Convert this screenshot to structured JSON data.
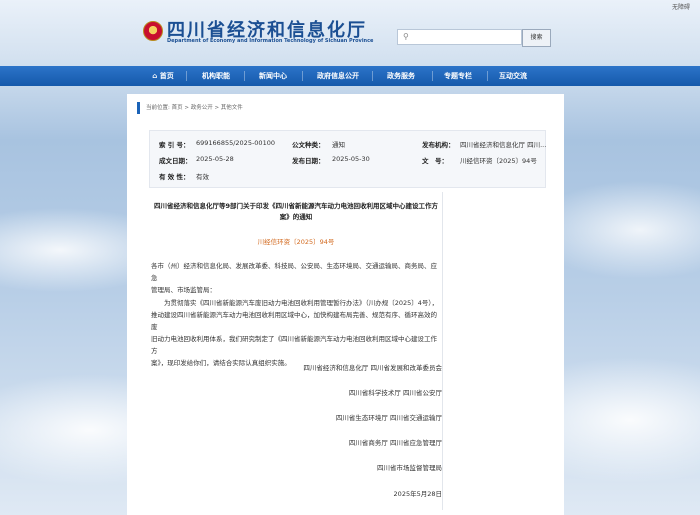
{
  "topbar": {
    "accessibility": "无障碍"
  },
  "header": {
    "site_name": "四川省经济和信息化厅",
    "site_name_en": "Department of Economy and Information Technology of Sichuan Province",
    "search_placeholder": "",
    "search_button": "搜索"
  },
  "nav": [
    {
      "label": "首页",
      "icon": "home-icon"
    },
    {
      "label": "机构职能"
    },
    {
      "label": "新闻中心"
    },
    {
      "label": "政府信息公开"
    },
    {
      "label": "政务服务"
    },
    {
      "label": "专题专栏"
    },
    {
      "label": "互动交流"
    }
  ],
  "breadcrumb": "当前位置: 首页 > 政务公开 > 其他文件",
  "info": {
    "index_label": "索 引 号：",
    "index_value": "699166855/2025-00100",
    "category_label": "公文种类：",
    "category_value": "通知",
    "issuer_label": "发布机构：",
    "issuer_value": "四川省经济和信息化厅 四川...",
    "created_label": "成文日期：",
    "created_value": "2025-05-28",
    "published_label": "发布日期：",
    "published_value": "2025-05-30",
    "docno_label": "文　号：",
    "docno_value": "川经信环资〔2025〕94号",
    "validity_label": "有 效 性：",
    "validity_value": "有效"
  },
  "document": {
    "title_line1": "四川省经济和信息化厅等9部门关于印发《四川省新能源汽车动力电池回收利用区域中心建设工作方",
    "title_line2": "案》的通知",
    "doc_number": "川经信环资〔2025〕94号",
    "addressee_line1": "各市（州）经济和信息化局、发展改革委、科技局、公安局、生态环境局、交通运输局、商务局、应急",
    "addressee_line2": "管理局、市场监管局：",
    "body_line1": "　　为贯彻落实《四川省新能源汽车废旧动力电池回收利用管理暂行办法》（川办规〔2025〕4号），",
    "body_line2": "推动建设四川省新能源汽车动力电池回收利用区域中心，加快构建布局完善、规范有序、循环高效的废",
    "body_line3": "旧动力电池回收利用体系，我们研究制定了《四川省新能源汽车动力电池回收利用区域中心建设工作方",
    "body_line4": "案》，现印发给你们，请结合实际认真组织实施。",
    "signatures": [
      "四川省经济和信息化厅 四川省发展和改革委员会",
      "四川省科学技术厅 四川省公安厅",
      "四川省生态环境厅 四川省交通运输厅",
      "四川省商务厅 四川省应急管理厅",
      "四川省市场监督管理局"
    ],
    "date": "2025年5月28日"
  },
  "colors": {
    "nav_blue": "#1b63b8",
    "logo_blue": "#1b4f93",
    "docnum_orange": "#d2691e"
  }
}
